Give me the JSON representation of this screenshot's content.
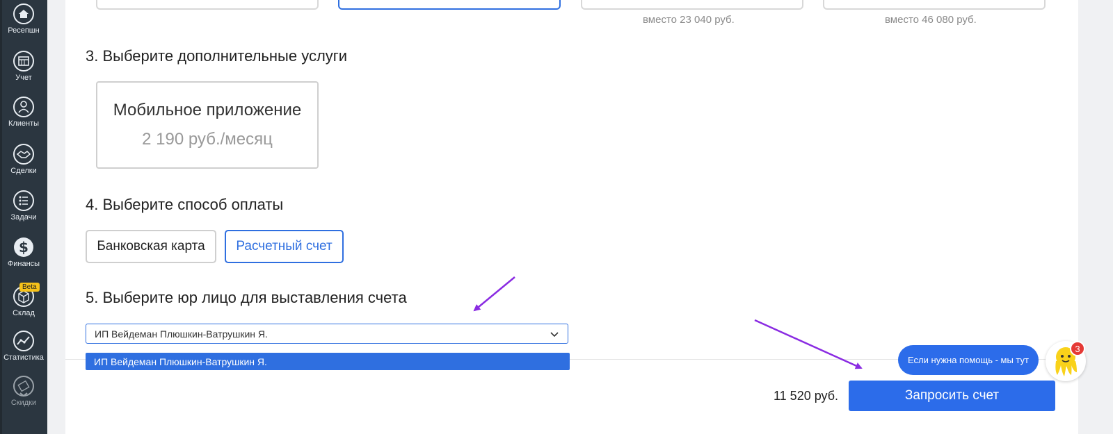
{
  "sidebar": {
    "items": [
      {
        "label": "Ресепшн",
        "icon": "home-icon"
      },
      {
        "label": "Учет",
        "icon": "calendar-icon"
      },
      {
        "label": "Клиенты",
        "icon": "clients-icon"
      },
      {
        "label": "Сделки",
        "icon": "handshake-icon"
      },
      {
        "label": "Задачи",
        "icon": "tasks-list-icon"
      },
      {
        "label": "Финансы",
        "icon": "dollar-icon"
      },
      {
        "label": "Склад",
        "icon": "box-icon"
      },
      {
        "label": "Статистика",
        "icon": "chart-line-icon"
      },
      {
        "label": "Скидки",
        "icon": "sale-tag-icon"
      }
    ],
    "beta_badge": "Beta"
  },
  "tariffs": {
    "notes": [
      "вместо 23 040 руб.",
      "вместо 46 080 руб."
    ]
  },
  "step3": {
    "title": "3. Выберите дополнительные услуги",
    "service": {
      "name": "Мобильное приложение",
      "price": "2 190 руб./месяц"
    }
  },
  "step4": {
    "title": "4. Выберите способ оплаты",
    "options": [
      "Банковская карта",
      "Расчетный счет"
    ],
    "selected": "Расчетный счет"
  },
  "step5": {
    "title": "5. Выберите юр лицо для выставления счета",
    "selected_value": "ИП Вейдеман Плюшкин-Ватрушкин Я.",
    "dropdown_option": "ИП Вейдеман Плюшкин-Ватрушкин Я."
  },
  "footer": {
    "total": "11 520 руб.",
    "request_button": "Запросить счет"
  },
  "help": {
    "bubble_text": "Если нужна помощь - мы тут",
    "unread_count": "3"
  },
  "colors": {
    "accent": "#2c6cea",
    "sidebar_bg": "#2b3640",
    "annotation_arrow": "#8a2be2",
    "badge": "#e53935"
  }
}
